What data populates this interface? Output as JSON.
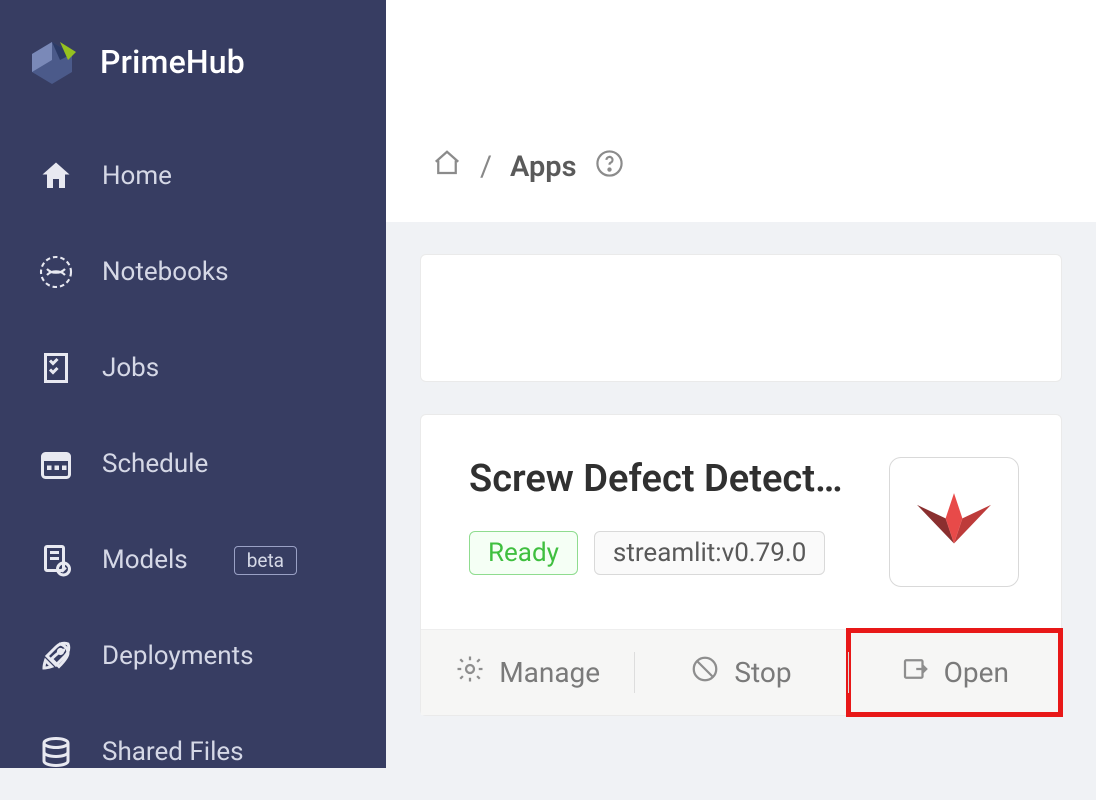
{
  "brand": {
    "name": "PrimeHub"
  },
  "sidebar": {
    "items": [
      {
        "label": "Home"
      },
      {
        "label": "Notebooks"
      },
      {
        "label": "Jobs"
      },
      {
        "label": "Schedule"
      },
      {
        "label": "Models",
        "badge": "beta"
      },
      {
        "label": "Deployments"
      },
      {
        "label": "Shared Files"
      }
    ]
  },
  "breadcrumb": {
    "current": "Apps"
  },
  "app_card": {
    "title": "Screw Defect Detect…",
    "status": "Ready",
    "runtime": "streamlit:v0.79.0",
    "thumb_icon": "streamlit-icon"
  },
  "actions": {
    "manage": "Manage",
    "stop": "Stop",
    "open": "Open"
  }
}
